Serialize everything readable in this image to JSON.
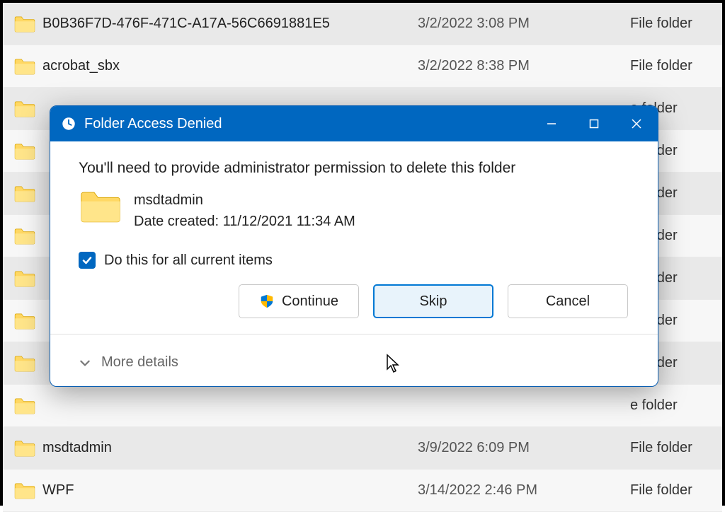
{
  "fileList": {
    "rows": [
      {
        "name": "B0B36F7D-476F-471C-A17A-56C6691881E5",
        "date": "3/2/2022 3:08 PM",
        "type": "File folder"
      },
      {
        "name": "acrobat_sbx",
        "date": "3/2/2022 8:38 PM",
        "type": "File folder"
      },
      {
        "name": "",
        "date": "",
        "type": "e folder"
      },
      {
        "name": "",
        "date": "",
        "type": "e folder"
      },
      {
        "name": "",
        "date": "",
        "type": "e folder"
      },
      {
        "name": "",
        "date": "",
        "type": "e folder"
      },
      {
        "name": "",
        "date": "",
        "type": "e folder"
      },
      {
        "name": "",
        "date": "",
        "type": "e folder"
      },
      {
        "name": "",
        "date": "",
        "type": "e folder"
      },
      {
        "name": "",
        "date": "",
        "type": "e folder"
      },
      {
        "name": "msdtadmin",
        "date": "3/9/2022 6:09 PM",
        "type": "File folder"
      },
      {
        "name": "WPF",
        "date": "3/14/2022 2:46 PM",
        "type": "File folder"
      }
    ]
  },
  "dialog": {
    "title": "Folder Access Denied",
    "message": "You'll need to provide administrator permission to delete this folder",
    "folderName": "msdtadmin",
    "folderDateLabel": "Date created: 11/12/2021 11:34 AM",
    "checkboxLabel": "Do this for all current items",
    "checkboxChecked": true,
    "buttons": {
      "continue": "Continue",
      "skip": "Skip",
      "cancel": "Cancel"
    },
    "moreDetails": "More details"
  }
}
